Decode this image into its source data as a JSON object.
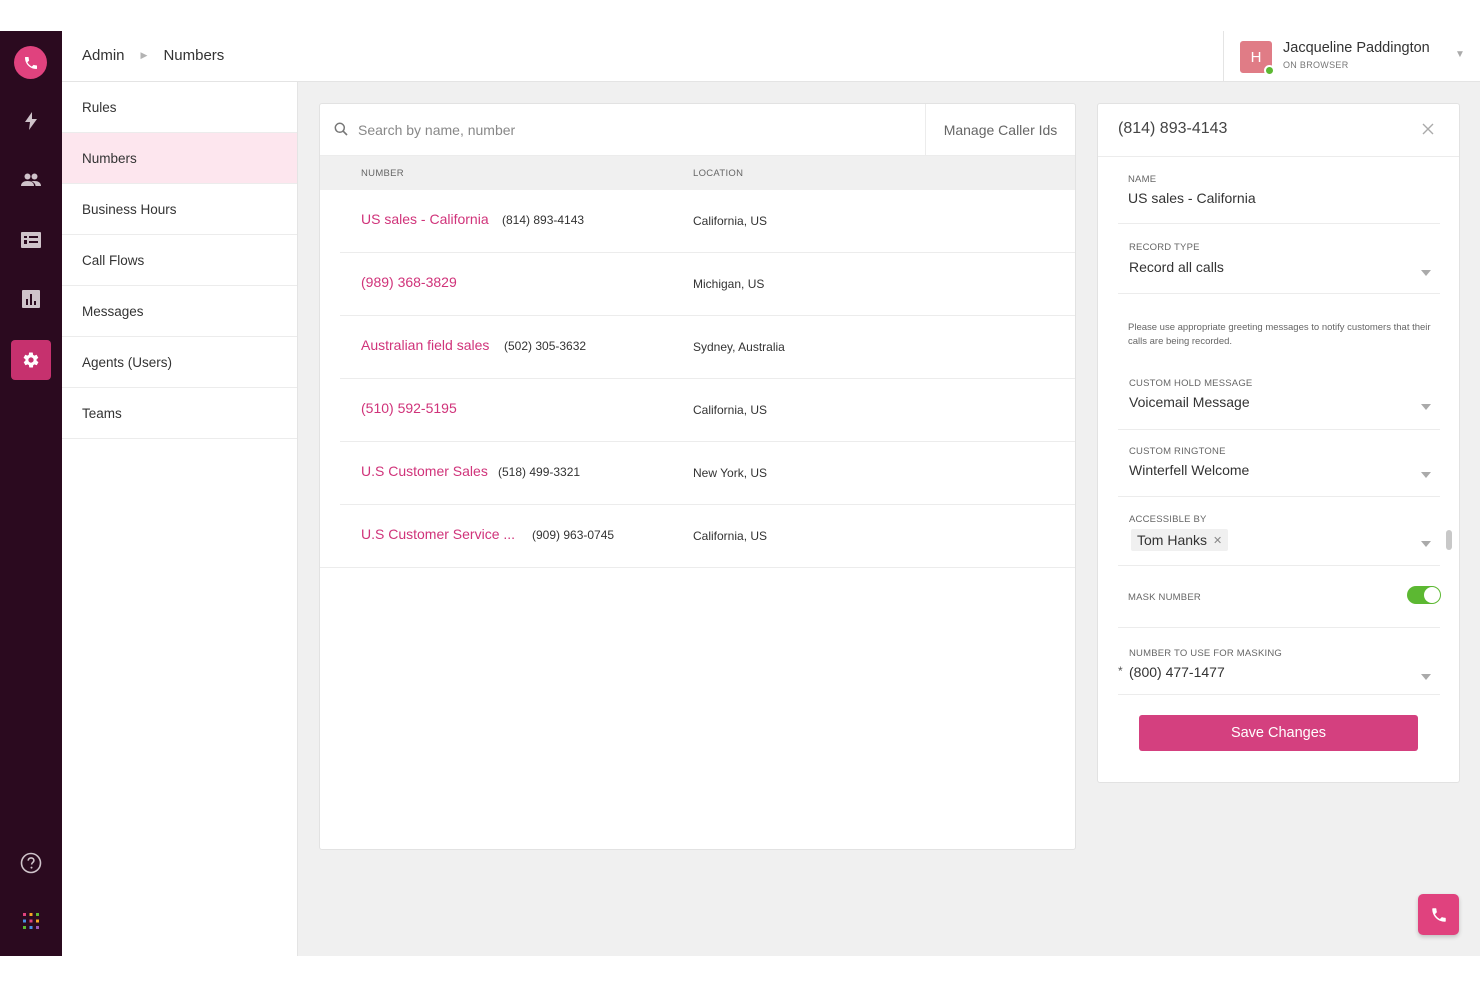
{
  "header": {
    "breadcrumb": [
      "Admin",
      "Numbers"
    ],
    "user_name": "Jacqueline Paddington",
    "user_status": "ON BROWSER",
    "avatar_initial": "H"
  },
  "rail": {
    "icons": [
      "phone-icon",
      "bolt-icon",
      "people-icon",
      "contact-card-icon",
      "bar-chart-icon",
      "gear-icon",
      "help-icon",
      "apps-grid-icon"
    ],
    "active": "gear-icon"
  },
  "subnav": {
    "items": [
      "Rules",
      "Numbers",
      "Business Hours",
      "Call Flows",
      "Messages",
      "Agents (Users)",
      "Teams"
    ],
    "active": "Numbers"
  },
  "search": {
    "placeholder": "Search by name, number",
    "value": ""
  },
  "manage_caller_ids": "Manage Caller Ids",
  "table": {
    "columns": [
      "NUMBER",
      "LOCATION"
    ],
    "rows": [
      {
        "name": "US sales - California",
        "number": "(814) 893-4143",
        "location": "California, US"
      },
      {
        "name": "(989) 368-3829",
        "number": "",
        "location": "Michigan, US"
      },
      {
        "name": "Australian field sales",
        "number": "(502) 305-3632",
        "location": "Sydney, Australia"
      },
      {
        "name": "(510) 592-5195",
        "number": "",
        "location": "California, US"
      },
      {
        "name": "U.S Customer Sales",
        "number": "(518) 499-3321",
        "location": "New York, US"
      },
      {
        "name": "U.S Customer Service ...",
        "number": "(909) 963-0745",
        "location": "California, US"
      }
    ]
  },
  "detail": {
    "title": "(814) 893-4143",
    "name_label": "NAME",
    "name_value": "US sales - California",
    "record_type_label": "RECORD TYPE",
    "record_type_value": "Record all calls",
    "record_note": "Please use appropriate greeting messages to notify customers that their calls are being recorded.",
    "hold_label": "CUSTOM HOLD MESSAGE",
    "hold_value": "Voicemail Message",
    "ringtone_label": "CUSTOM RINGTONE",
    "ringtone_value": "Winterfell Welcome",
    "accessible_label": "ACCESSIBLE BY",
    "accessible_chips": [
      "Tom Hanks"
    ],
    "mask_label": "MASK NUMBER",
    "mask_enabled": true,
    "masking_number_label": "NUMBER TO USE FOR MASKING",
    "masking_number_value": "(800) 477-1477",
    "required_mark": "*",
    "save_label": "Save Changes"
  },
  "colors": {
    "rail_bg": "#2b0a1f",
    "accent": "#d4407f",
    "toggle_on": "#5cb832"
  }
}
